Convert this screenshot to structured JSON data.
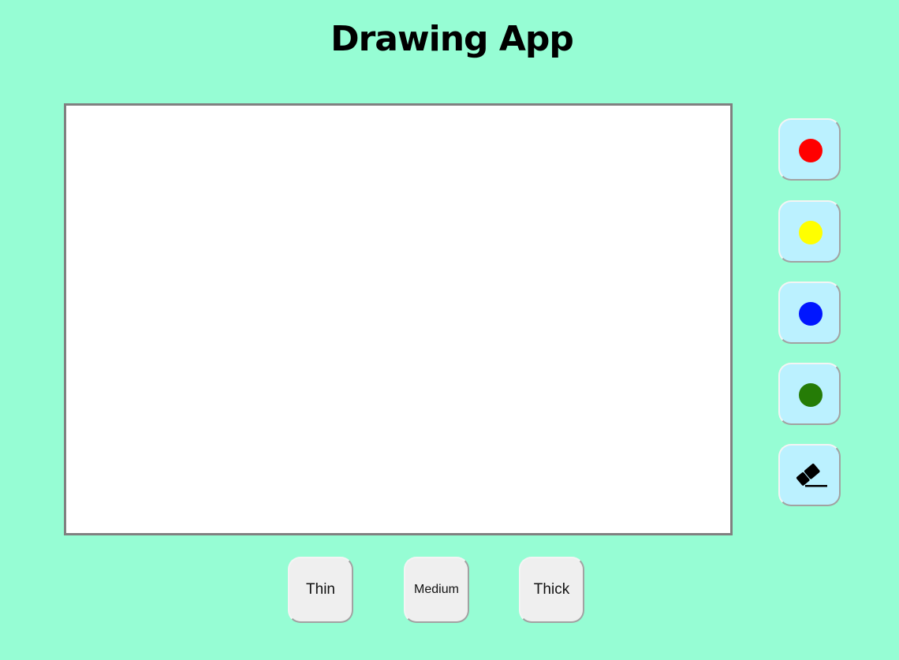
{
  "app": {
    "title": "Drawing App"
  },
  "colors": {
    "background": "#96fdd4",
    "canvas": "#ffffff",
    "tool_button": "#bbf1ff",
    "size_button": "#efefef"
  },
  "tools": [
    {
      "name": "red-color-button",
      "icon": "red-swatch",
      "color": "#ff0000"
    },
    {
      "name": "yellow-color-button",
      "icon": "yellow-swatch",
      "color": "#ffff00"
    },
    {
      "name": "blue-color-button",
      "icon": "blue-swatch",
      "color": "#0016ff"
    },
    {
      "name": "green-color-button",
      "icon": "green-swatch",
      "color": "#257c06"
    },
    {
      "name": "eraser-button",
      "icon": "eraser-icon"
    }
  ],
  "sizes": [
    {
      "label": "Thin"
    },
    {
      "label": "Medium"
    },
    {
      "label": "Thick"
    }
  ]
}
